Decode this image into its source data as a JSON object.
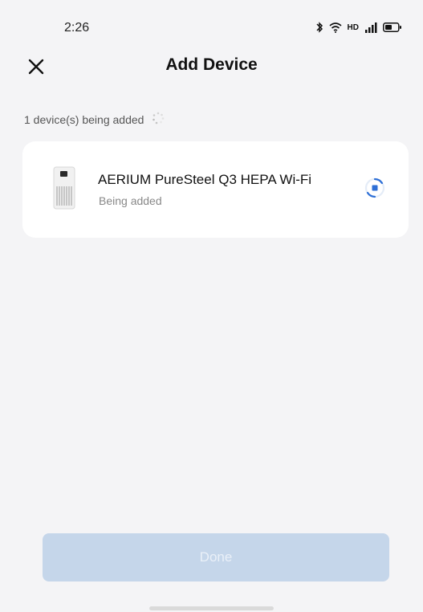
{
  "status_bar": {
    "time": "2:26",
    "network_label": "HD",
    "icons": [
      "bluetooth-icon",
      "wifi-icon",
      "signal-icon",
      "battery-icon"
    ]
  },
  "header": {
    "title": "Add Device",
    "close_icon": "close-icon"
  },
  "adding_status": {
    "text": "1 device(s) being added",
    "icon": "loading-spinner-icon"
  },
  "device": {
    "name": "AERIUM PureSteel Q3 HEPA Wi-Fi",
    "state": "Being added",
    "image_icon": "air-purifier-icon",
    "progress_icon": "progress-indicator-icon"
  },
  "footer": {
    "done_label": "Done"
  },
  "colors": {
    "background": "#f4f4f6",
    "card": "#ffffff",
    "accent": "#2e6fd6",
    "done_disabled": "#c5d6ea"
  }
}
